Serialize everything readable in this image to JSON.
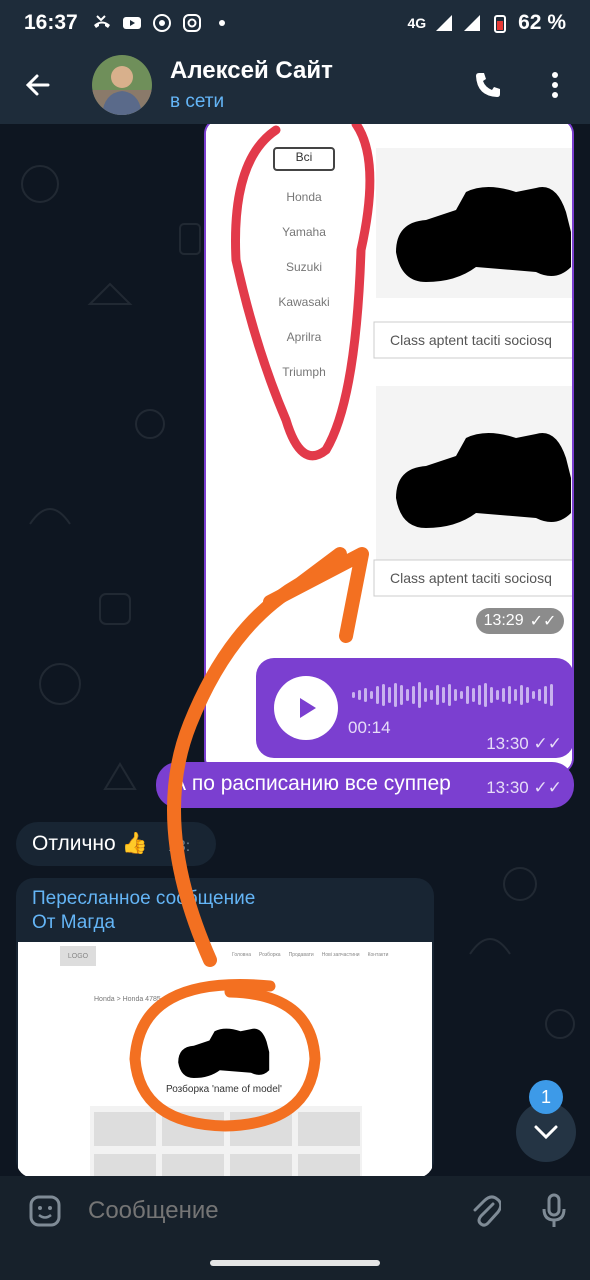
{
  "status_bar": {
    "time": "16:37",
    "network": "4G",
    "battery": "62 %",
    "left_icons": [
      "missed-call-icon",
      "youtube-icon",
      "chrome-icon",
      "instagram-icon",
      "dot-icon"
    ]
  },
  "header": {
    "contact_name": "Алексей Сайт",
    "contact_status": "в сети"
  },
  "messages": {
    "image_msg": {
      "filter_items": [
        "Всі",
        "Honda",
        "Yamaha",
        "Suzuki",
        "Kawasaki",
        "Aprilra",
        "Triumph"
      ],
      "card_caption_1": "Class aptent taciti sociosq",
      "card_caption_2": "Class aptent taciti sociosq",
      "time": "13:29"
    },
    "voice_msg": {
      "duration": "00:14",
      "time": "13:30"
    },
    "out_text": {
      "text": "А по расписанию все суппер",
      "time": "13:30"
    },
    "in_text": {
      "text": "Отлично 👍",
      "time": "13:"
    },
    "forwarded": {
      "header": "Пересланное сообщение",
      "from": "От Магда",
      "site_logo": "LOGO",
      "site_nav": [
        "Головна",
        "Розборка",
        "Продавати",
        "Нові запчастини",
        "Контакти"
      ],
      "site_breadcrumb": "Honda > Honda 4785",
      "site_caption": "Розборка 'name of model'"
    }
  },
  "scroll": {
    "unread_count": "1"
  },
  "input": {
    "placeholder": "Сообщение"
  },
  "colors": {
    "outgoing": "#7b3fd0",
    "incoming": "#182533",
    "link": "#64b5f6",
    "annotation_red": "#e23a4a",
    "annotation_orange": "#f37021"
  }
}
